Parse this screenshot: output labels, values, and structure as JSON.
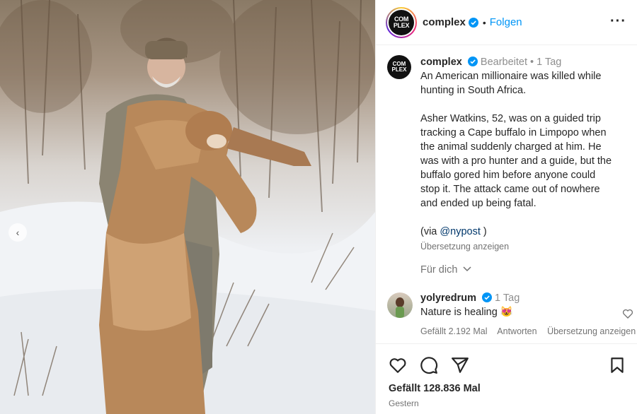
{
  "post": {
    "account": "complex",
    "avatar_text": "COM PLEX",
    "follow_label": "Folgen",
    "more_icon": "more-horizontal-icon"
  },
  "caption": {
    "username": "complex",
    "edited_label": "Bearbeitet",
    "time": "1 Tag",
    "line1": "An American millionaire was killed while",
    "line2": "hunting in South Africa.",
    "para2_l1": "Asher Watkins, 52, was on a guided trip",
    "para2_l2": "tracking a Cape buffalo in Limpopo when",
    "para2_l3": "the animal suddenly charged at him. He",
    "para2_l4": "was with a pro hunter and a guide, but the",
    "para2_l5": "buffalo gored him before anyone could",
    "para2_l6": "stop it. The attack came out of nowhere",
    "para2_l7": "and ended up being fatal.",
    "via_prefix": "(via ",
    "via_mention": "@nypost",
    "via_suffix": " )",
    "translate_label": "Übersetzung anzeigen",
    "for_you_label": "Für dich"
  },
  "comment": {
    "username": "yolyredrum",
    "time": "1 Tag",
    "text": "Nature is healing",
    "emoji": "😻",
    "likes_label": "Gefällt 2.192 Mal",
    "reply_label": "Antworten",
    "translate_label": "Übersetzung anzeigen"
  },
  "footer": {
    "likes_label": "Gefällt 128.836 Mal",
    "date_label": "Gestern"
  },
  "colors": {
    "accent": "#0095f6",
    "verified": "#0095f6",
    "text": "#262626",
    "muted": "#737373"
  }
}
